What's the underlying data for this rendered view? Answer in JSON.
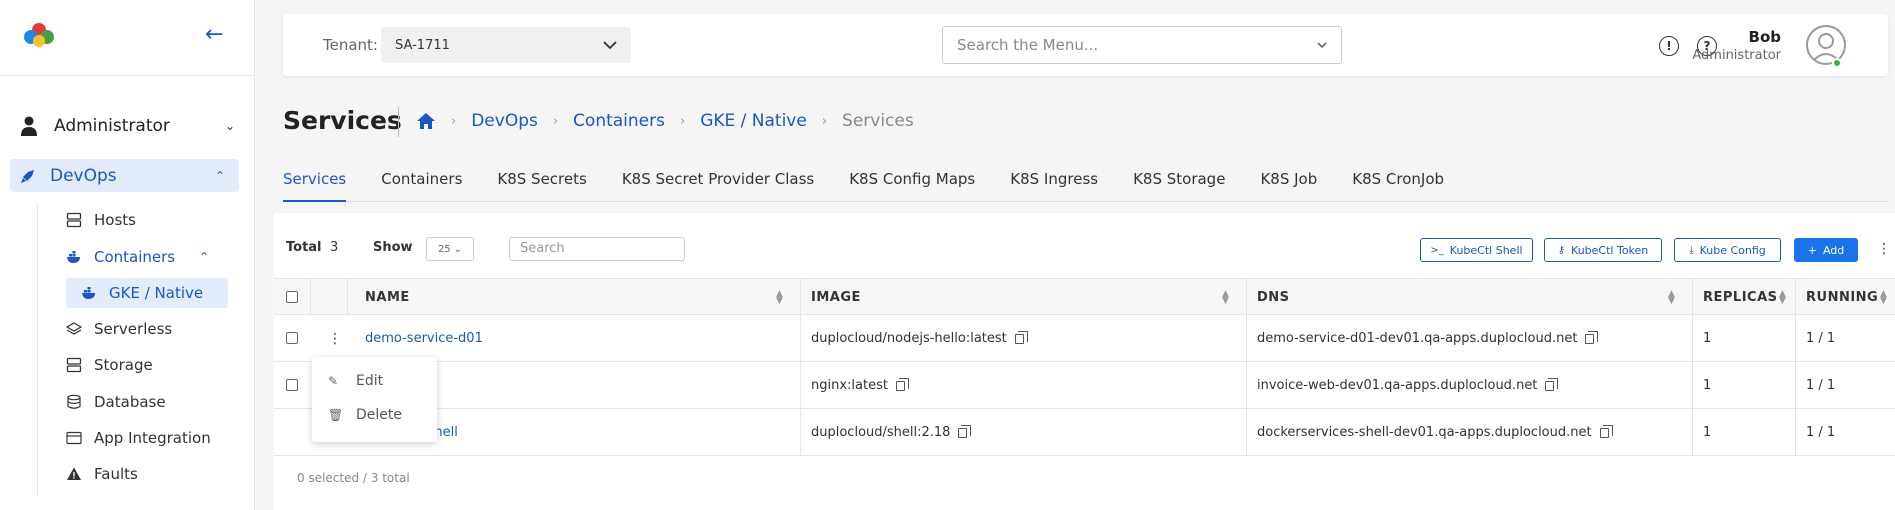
{
  "sidebar": {
    "admin_label": "Administrator",
    "devops_label": "DevOps",
    "items": [
      {
        "label": "Hosts",
        "icon": "hosts-icon"
      },
      {
        "label": "Containers",
        "icon": "docker-icon"
      },
      {
        "label": "GKE / Native",
        "icon": "docker-icon"
      },
      {
        "label": "Serverless",
        "icon": "layers-icon"
      },
      {
        "label": "Storage",
        "icon": "storage-icon"
      },
      {
        "label": "Database",
        "icon": "database-icon"
      },
      {
        "label": "App Integration",
        "icon": "app-integration-icon"
      },
      {
        "label": "Faults",
        "icon": "warning-icon"
      }
    ]
  },
  "header": {
    "tenant_label": "Tenant:",
    "tenant_value": "SA-1711",
    "search_placeholder": "Search the Menu...",
    "user_name": "Bob",
    "user_role": "Administrator"
  },
  "page": {
    "title": "Services",
    "breadcrumb": [
      "DevOps",
      "Containers",
      "GKE / Native",
      "Services"
    ]
  },
  "tabs": [
    "Services",
    "Containers",
    "K8S Secrets",
    "K8S Secret Provider Class",
    "K8S Config Maps",
    "K8S Ingress",
    "K8S Storage",
    "K8S Job",
    "K8S CronJob"
  ],
  "toolbar": {
    "total_label": "Total",
    "total_value": "3",
    "show_label": "Show",
    "show_value": "25",
    "search_placeholder": "Search",
    "kubectl_shell": "KubeCtl Shell",
    "kubectl_token": "KubeCtl Token",
    "kube_config": "Kube Config",
    "add": "Add"
  },
  "table": {
    "columns": [
      "NAME",
      "IMAGE",
      "DNS",
      "REPLICAS",
      "RUNNING"
    ],
    "rows": [
      {
        "name": "demo-service-d01",
        "image": "duplocloud/nodejs-hello:latest",
        "dns": "demo-service-d01-dev01.qa-apps.duplocloud.net",
        "replicas": "1",
        "running": "1 / 1"
      },
      {
        "name": "",
        "image": "nginx:latest",
        "dns": "invoice-web-dev01.qa-apps.duplocloud.net",
        "replicas": "1",
        "running": "1 / 1"
      },
      {
        "name": "ces-shell",
        "image": "duplocloud/shell:2.18",
        "dns": "dockerservices-shell-dev01.qa-apps.duplocloud.net",
        "replicas": "1",
        "running": "1 / 1"
      }
    ],
    "footer": "0 selected / 3 total"
  },
  "context_menu": {
    "edit": "Edit",
    "delete": "Delete"
  },
  "colors": {
    "accent": "#1a56c4",
    "active_bg": "#e3ecfb",
    "online": "#2bb34a"
  }
}
